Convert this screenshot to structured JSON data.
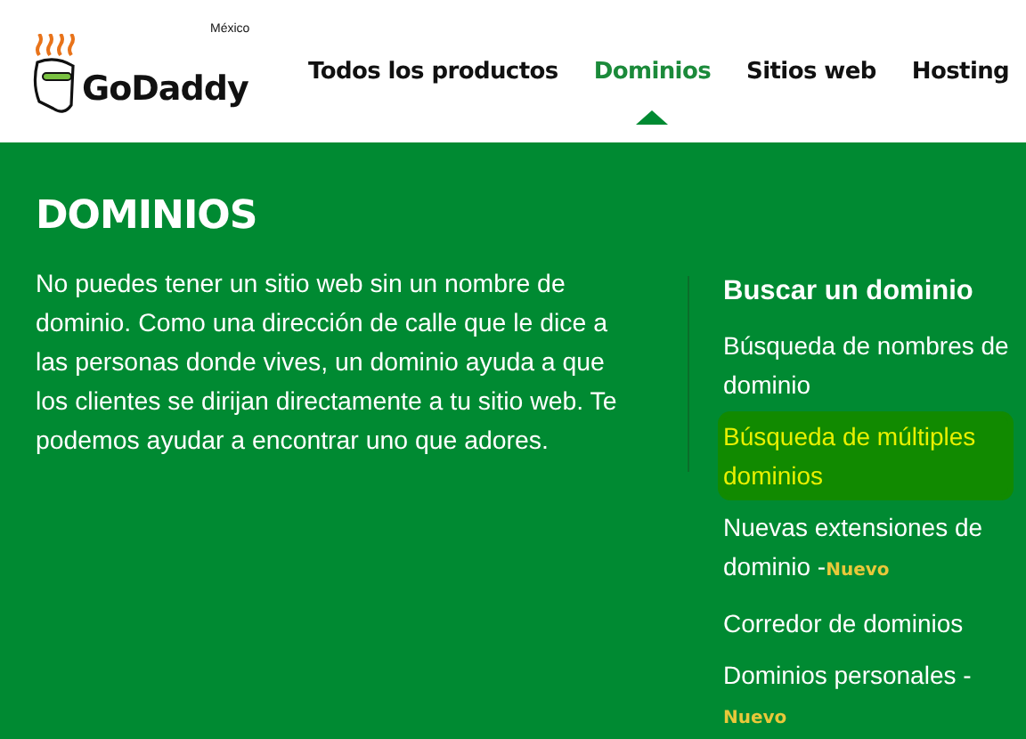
{
  "header": {
    "logo": {
      "wordmark": "GoDaddy",
      "region": "México"
    },
    "nav": [
      {
        "label": "Todos los productos",
        "selected": false
      },
      {
        "label": "Dominios",
        "selected": true
      },
      {
        "label": "Sitios web",
        "selected": false
      },
      {
        "label": "Hosting",
        "selected": false
      }
    ]
  },
  "panel": {
    "title": "DOMINIOS",
    "description": "No puedes tener un sitio web sin un nombre de dominio. Como una dirección de calle que le dice a las personas donde vives, un dominio ayuda a que los clientes se dirijan directamente a tu sitio web. Te podemos ayudar a encontrar uno que adores.",
    "section": {
      "title": "Buscar un dominio",
      "links": [
        {
          "label": "Búsqueda de nombres de dominio",
          "highlighted": false
        },
        {
          "label": "Búsqueda de múltiples dominios",
          "highlighted": true
        },
        {
          "label": "Nuevas extensiones de dominio -",
          "highlighted": false,
          "badge": "Nuevo"
        },
        {
          "label": "Corredor de dominios",
          "highlighted": false
        },
        {
          "label": "Dominios personales -",
          "highlighted": false,
          "badge": "Nuevo"
        }
      ]
    }
  }
}
